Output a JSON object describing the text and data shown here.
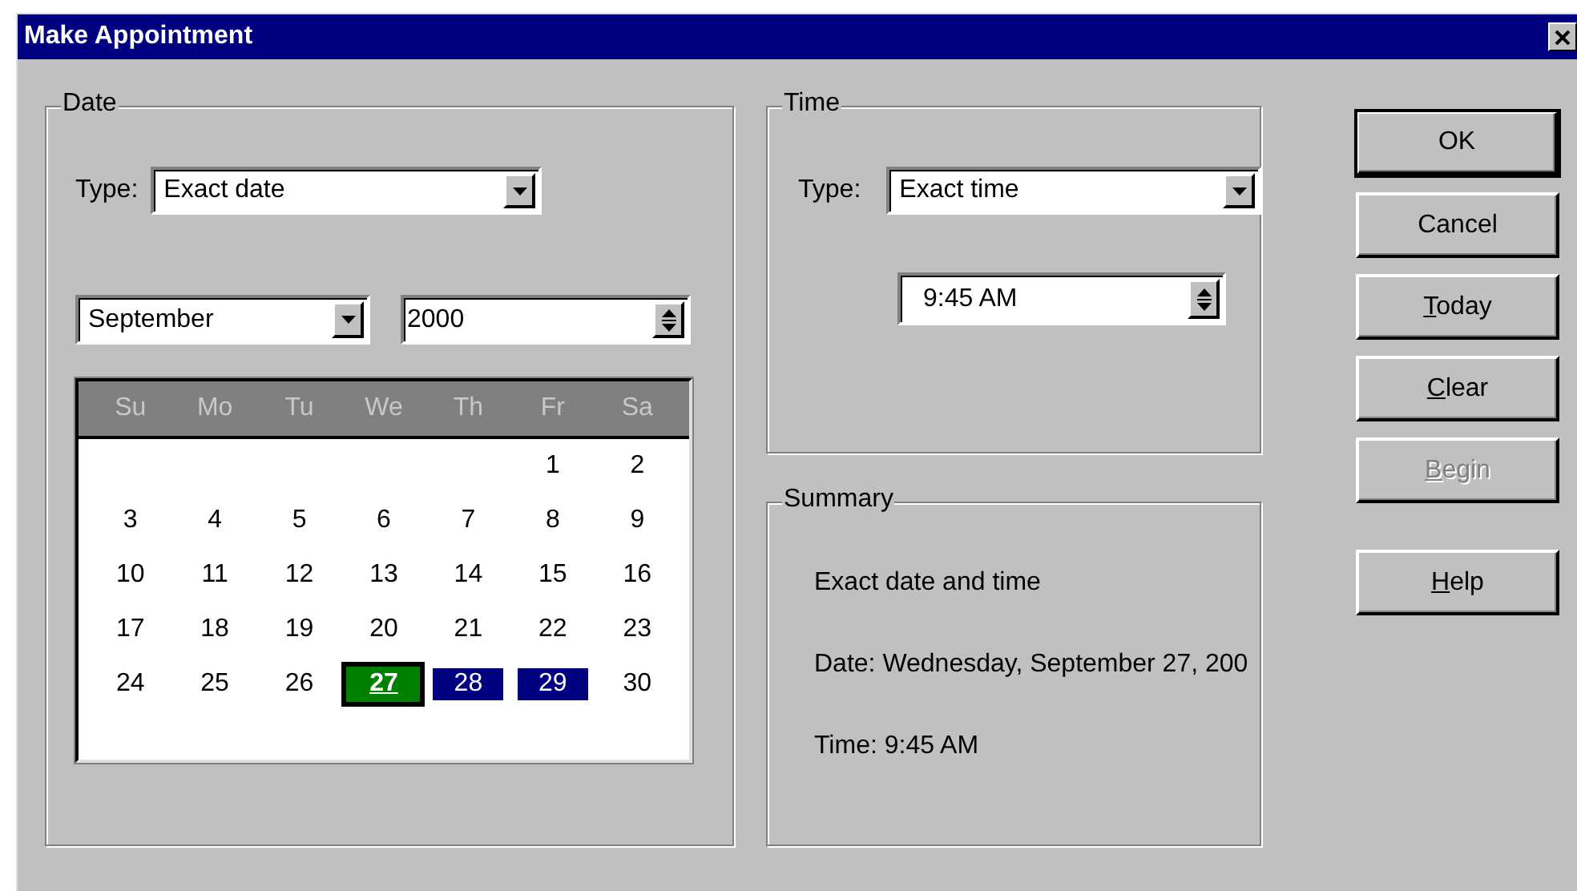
{
  "window": {
    "title": "Make Appointment"
  },
  "date": {
    "legend": "Date",
    "type_label": "Type:",
    "type_value": "Exact date",
    "month": "September",
    "year": "2000",
    "calendar": {
      "weekdays": [
        "Su",
        "Mo",
        "Tu",
        "We",
        "Th",
        "Fr",
        "Sa"
      ],
      "weeks": [
        {
          "right_aligned": true,
          "days": [
            {
              "day": "1",
              "selected": false,
              "highlighted": false
            },
            {
              "day": "2",
              "selected": false,
              "highlighted": false
            }
          ]
        },
        {
          "days": [
            {
              "day": "3",
              "selected": false,
              "highlighted": false
            },
            {
              "day": "4",
              "selected": false,
              "highlighted": false
            },
            {
              "day": "5",
              "selected": false,
              "highlighted": false
            },
            {
              "day": "6",
              "selected": false,
              "highlighted": false
            },
            {
              "day": "7",
              "selected": false,
              "highlighted": false
            },
            {
              "day": "8",
              "selected": false,
              "highlighted": false
            },
            {
              "day": "9",
              "selected": false,
              "highlighted": false
            }
          ]
        },
        {
          "days": [
            {
              "day": "10",
              "selected": false,
              "highlighted": false
            },
            {
              "day": "11",
              "selected": false,
              "highlighted": false
            },
            {
              "day": "12",
              "selected": false,
              "highlighted": false
            },
            {
              "day": "13",
              "selected": false,
              "highlighted": false
            },
            {
              "day": "14",
              "selected": false,
              "highlighted": false
            },
            {
              "day": "15",
              "selected": false,
              "highlighted": false
            },
            {
              "day": "16",
              "selected": false,
              "highlighted": false
            }
          ]
        },
        {
          "days": [
            {
              "day": "17",
              "selected": false,
              "highlighted": false
            },
            {
              "day": "18",
              "selected": false,
              "highlighted": false
            },
            {
              "day": "19",
              "selected": false,
              "highlighted": false
            },
            {
              "day": "20",
              "selected": false,
              "highlighted": false
            },
            {
              "day": "21",
              "selected": false,
              "highlighted": false
            },
            {
              "day": "22",
              "selected": false,
              "highlighted": false
            },
            {
              "day": "23",
              "selected": false,
              "highlighted": false
            }
          ]
        },
        {
          "days": [
            {
              "day": "24",
              "selected": false,
              "highlighted": false
            },
            {
              "day": "25",
              "selected": false,
              "highlighted": false
            },
            {
              "day": "26",
              "selected": false,
              "highlighted": false
            },
            {
              "day": "27",
              "selected": true,
              "highlighted": false
            },
            {
              "day": "28",
              "selected": false,
              "highlighted": true
            },
            {
              "day": "29",
              "selected": false,
              "highlighted": true
            },
            {
              "day": "30",
              "selected": false,
              "highlighted": false
            }
          ]
        }
      ]
    }
  },
  "time": {
    "legend": "Time",
    "type_label": "Type:",
    "type_value": "Exact time",
    "value": "9:45 AM"
  },
  "summary": {
    "legend": "Summary",
    "lines": [
      "Exact date and time",
      "Date: Wednesday, September 27, 200",
      "Time: 9:45 AM"
    ]
  },
  "buttons": [
    {
      "label": "OK",
      "default": true,
      "underline_first": false,
      "disabled": false
    },
    {
      "label": "Cancel",
      "default": false,
      "underline_first": false,
      "disabled": false
    },
    {
      "label": "Today",
      "default": false,
      "underline_first": true,
      "disabled": false
    },
    {
      "label": "Clear",
      "default": false,
      "underline_first": true,
      "disabled": false
    },
    {
      "label": "Begin",
      "default": false,
      "underline_first": true,
      "disabled": true
    },
    {
      "label": "Help",
      "default": false,
      "underline_first": true,
      "disabled": false
    }
  ]
}
